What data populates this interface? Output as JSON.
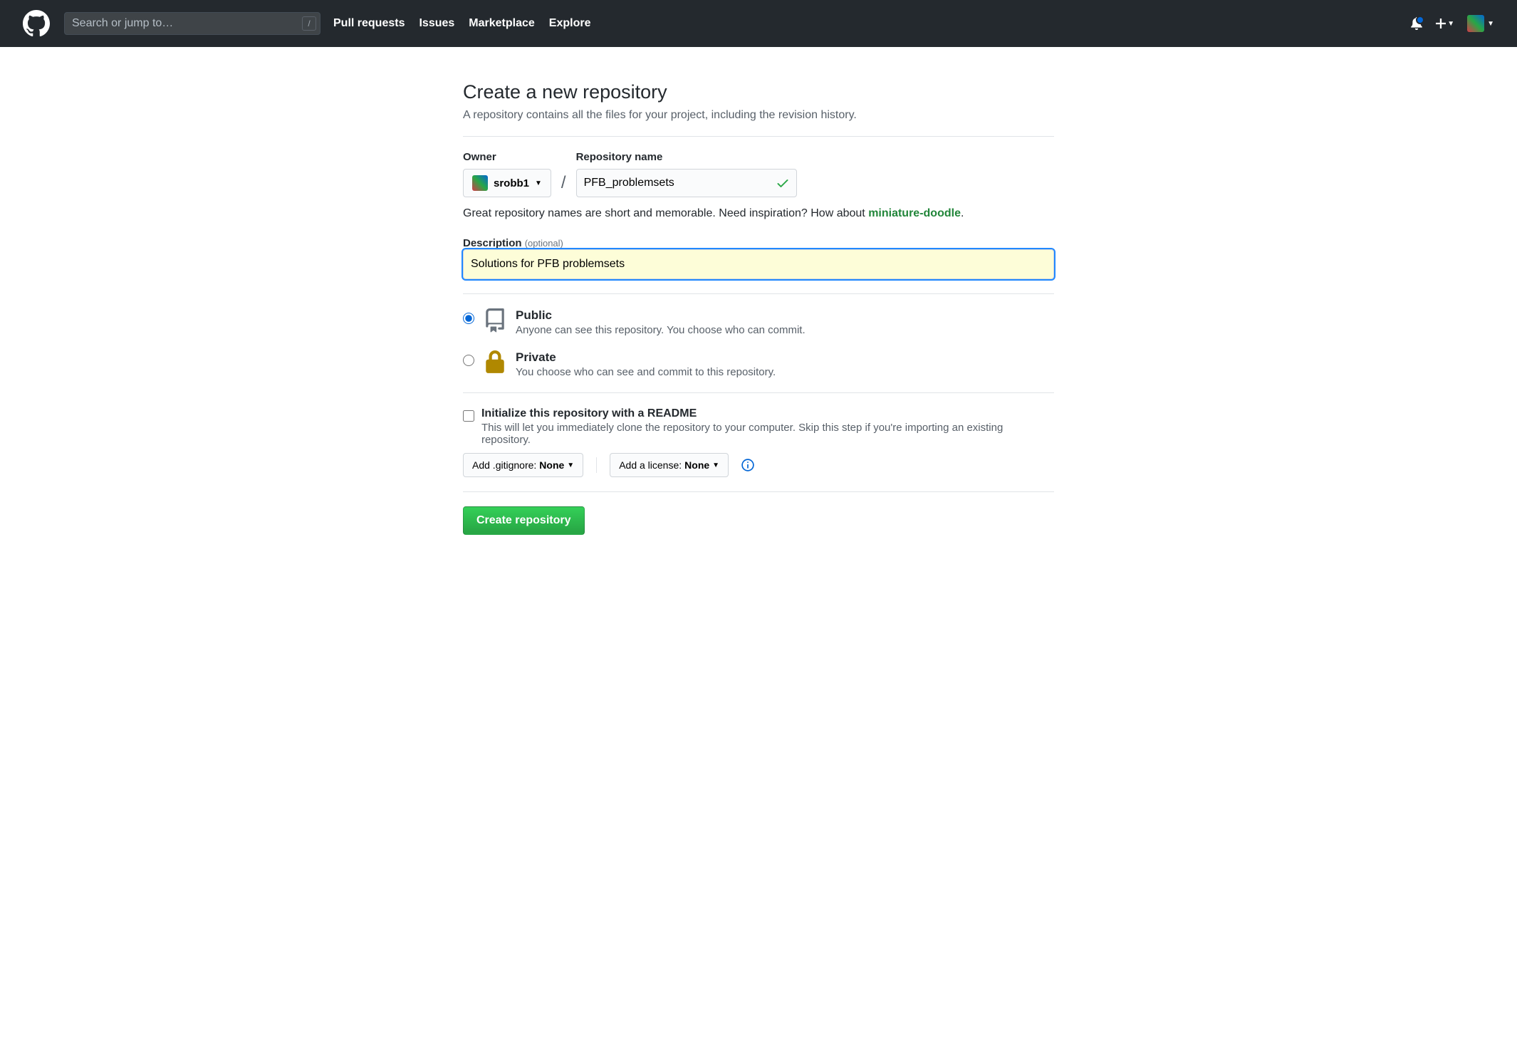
{
  "header": {
    "search_placeholder": "Search or jump to…",
    "search_key": "/",
    "nav": [
      "Pull requests",
      "Issues",
      "Marketplace",
      "Explore"
    ]
  },
  "page": {
    "title": "Create a new repository",
    "subtitle": "A repository contains all the files for your project, including the revision history."
  },
  "form": {
    "owner_label": "Owner",
    "owner_value": "srobb1",
    "reponame_label": "Repository name",
    "reponame_value": "PFB_problemsets",
    "hint_prefix": "Great repository names are short and memorable. Need inspiration? How about ",
    "hint_suggestion": "miniature-doodle",
    "hint_suffix": ".",
    "desc_label": "Description",
    "desc_optional": "(optional)",
    "desc_value": "Solutions for PFB problemsets",
    "visibility": {
      "public": {
        "title": "Public",
        "desc": "Anyone can see this repository. You choose who can commit."
      },
      "private": {
        "title": "Private",
        "desc": "You choose who can see and commit to this repository."
      }
    },
    "readme": {
      "title": "Initialize this repository with a README",
      "desc": "This will let you immediately clone the repository to your computer. Skip this step if you're importing an existing repository."
    },
    "gitignore_label": "Add .gitignore: ",
    "gitignore_value": "None",
    "license_label": "Add a license: ",
    "license_value": "None",
    "submit": "Create repository"
  }
}
